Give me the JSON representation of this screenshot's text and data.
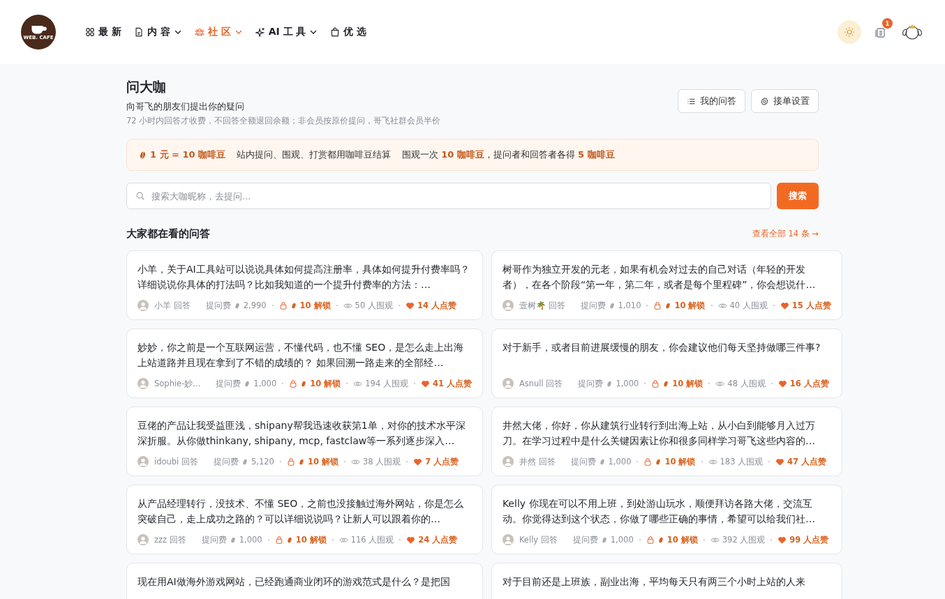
{
  "header": {
    "logo_text": "WEB. CAFE",
    "nav": [
      {
        "label": "最 新",
        "dropdown": false,
        "selected": false
      },
      {
        "label": "内 容",
        "dropdown": true,
        "selected": false
      },
      {
        "label": "社 区",
        "dropdown": true,
        "selected": true
      },
      {
        "label": "AI 工 具",
        "dropdown": true,
        "selected": false
      },
      {
        "label": "优 选",
        "dropdown": false,
        "selected": false
      }
    ],
    "notification_count": "1"
  },
  "page": {
    "title": "问大咖",
    "subtitle": "向哥飞的朋友们提出你的疑问",
    "note": "72 小时内回答才收费，不回答全额退回余额；非会员按原价提问，哥飞社群会员半价",
    "buttons": [
      {
        "label": "我的问答"
      },
      {
        "label": "接单设置"
      }
    ]
  },
  "notice": {
    "rate": "1 元 = 10 咖啡豆",
    "text_1": "站内提问、围观、打赏都用咖啡豆结算",
    "text_2": "围观一次 **10 咖啡豆**，提问者和回答者各得 **5 咖啡豆**"
  },
  "search": {
    "placeholder": "搜索大咖昵称，去提问...",
    "button": "搜索"
  },
  "section": {
    "title": "大家都在看的问答",
    "link": "查看全部 14 条 →"
  },
  "questions": [
    {
      "text": "小羊，关于AI工具站可以说说具体如何提高注册率，具体如何提升付费率吗？详细说说你具体的打法吗？比如我知道的一个提升付费率的方法：…",
      "author": "小羊 回答",
      "fee_label": "提问费",
      "fee": "2,990",
      "unlock": "10 解锁",
      "views": "50 人围观",
      "likes": "14 人点赞"
    },
    {
      "text": "树哥作为独立开发的元老，如果有机会对过去的自己对话（年轻的开发者），在各个阶段“第一年，第二年，或者是每个里程碑”，你会想说什…",
      "author": "壹树🌴 回答",
      "fee_label": "提问费",
      "fee": "1,010",
      "unlock": "10 解锁",
      "views": "40 人围观",
      "likes": "15 人点赞"
    },
    {
      "text": "妙妙，你之前是一个互联网运营，不懂代码，也不懂 SEO，是怎么走上出海上站道路并且现在拿到了不错的成绩的？ 如果回溯一路走来的全部经…",
      "author": "Sophie-妙...",
      "fee_label": "提问费",
      "fee": "1,000",
      "unlock": "10 解锁",
      "views": "194 人围观",
      "likes": "41 人点赞"
    },
    {
      "text": "对于新手，或者目前进展缓慢的朋友，你会建议他们每天坚持做哪三件事?",
      "author": "Asnull 回答",
      "fee_label": "提问费",
      "fee": "1,000",
      "unlock": "10 解锁",
      "views": "48 人围观",
      "likes": "16 人点赞"
    },
    {
      "text": "豆佬的产品让我受益匪浅，shipany帮我迅速收获第1单，对你的技术水平深深折服。从你做thinkany, shipany, mcp, fastclaw等一系列逐步深入…",
      "author": "idoubi 回答",
      "fee_label": "提问费",
      "fee": "5,120",
      "unlock": "10 解锁",
      "views": "38 人围观",
      "likes": "7 人点赞"
    },
    {
      "text": "井然大佬，你好，你从建筑行业转行到出海上站，从小白到能够月入过万刀。在学习过程中是什么关键因素让你和很多同样学习哥飞这些内容的…",
      "author": "井然 回答",
      "fee_label": "提问费",
      "fee": "1,000",
      "unlock": "10 解锁",
      "views": "183 人围观",
      "likes": "47 人点赞"
    },
    {
      "text": "从产品经理转行，没技术、不懂 SEO，之前也没接触过海外网站，你是怎么突破自己，走上成功之路的？可以详细说说吗？让新人可以跟着你的…",
      "author": "zzz 回答",
      "fee_label": "提问费",
      "fee": "1,000",
      "unlock": "10 解锁",
      "views": "116 人围观",
      "likes": "24 人点赞"
    },
    {
      "text": "Kelly 你现在可以不用上班，到处游山玩水，顺便拜访各路大佬，交流互动。你觉得达到这个状态，你做了哪些正确的事情，希望可以给我们社…",
      "author": "Kelly 回答",
      "fee_label": "提问费",
      "fee": "1,000",
      "unlock": "10 解锁",
      "views": "392 人围观",
      "likes": "99 人点赞"
    },
    {
      "text": "现在用AI做海外游戏网站，已经跑通商业闭环的游戏范式是什么？是把国"
    },
    {
      "text": "对于目前还是上班族，副业出海，平均每天只有两三个小时上站的人来"
    }
  ]
}
